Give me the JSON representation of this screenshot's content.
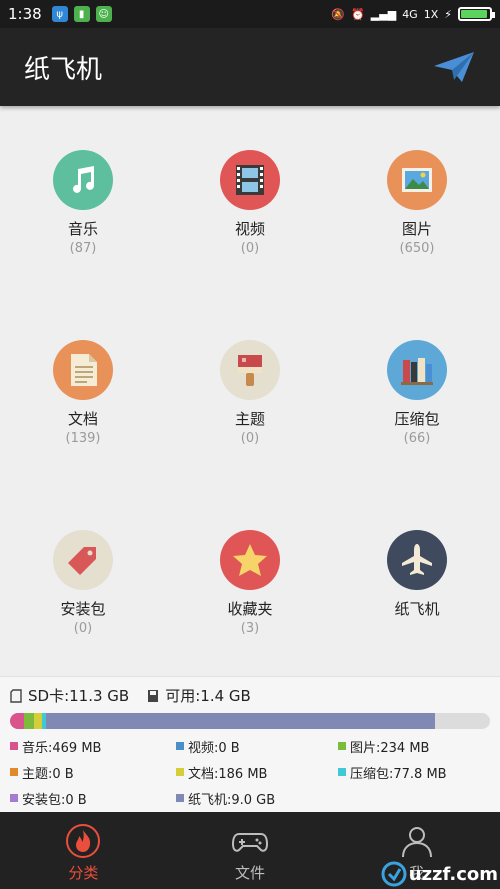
{
  "status_bar": {
    "time": "1:38",
    "network": "4G",
    "network2": "1X"
  },
  "app_bar": {
    "title": "纸飞机",
    "action_icon": "paper-plane-icon",
    "accent": "#4a8fd6"
  },
  "categories": [
    {
      "name": "音乐",
      "count": "(87)",
      "icon": "music-note-icon",
      "color": "#5dbf9d"
    },
    {
      "name": "视频",
      "count": "(0)",
      "icon": "film-icon",
      "color": "#e05555"
    },
    {
      "name": "图片",
      "count": "(650)",
      "icon": "picture-icon",
      "color": "#e8925a"
    },
    {
      "name": "文档",
      "count": "(139)",
      "icon": "document-icon",
      "color": "#e8925a"
    },
    {
      "name": "主题",
      "count": "(0)",
      "icon": "paint-brush-icon",
      "color": "#e4dfcf"
    },
    {
      "name": "压缩包",
      "count": "(66)",
      "icon": "books-icon",
      "color": "#5ea8d8"
    },
    {
      "name": "安装包",
      "count": "(0)",
      "icon": "tag-icon",
      "color": "#e4dfcf"
    },
    {
      "name": "收藏夹",
      "count": "(3)",
      "icon": "star-icon",
      "color": "#e05555"
    },
    {
      "name": "纸飞机",
      "count": "",
      "icon": "airplane-icon",
      "color": "#3f4a5e"
    }
  ],
  "storage": {
    "sd_label": "SD卡:11.3 GB",
    "available_label": "可用:1.4 GB",
    "used_fraction": 0.885,
    "legend": [
      {
        "label": "音乐:469 MB",
        "color": "#d9538c"
      },
      {
        "label": "视频:0 B",
        "color": "#4a8fc8"
      },
      {
        "label": "图片:234 MB",
        "color": "#7cbc3c"
      },
      {
        "label": "主题:0 B",
        "color": "#e08a2c"
      },
      {
        "label": "文档:186 MB",
        "color": "#d6cd3a"
      },
      {
        "label": "压缩包:77.8 MB",
        "color": "#3fc9d6"
      },
      {
        "label": "安装包:0 B",
        "color": "#a77bd4"
      },
      {
        "label": "纸飞机:9.0 GB",
        "color": "#8089b3"
      }
    ]
  },
  "bottom_nav": [
    {
      "label": "分类",
      "icon": "flame-icon",
      "active": true
    },
    {
      "label": "文件",
      "icon": "gamepad-icon",
      "active": false
    },
    {
      "label": "我",
      "icon": "person-icon",
      "active": false
    }
  ],
  "watermark": {
    "text": "uzzf.com"
  }
}
